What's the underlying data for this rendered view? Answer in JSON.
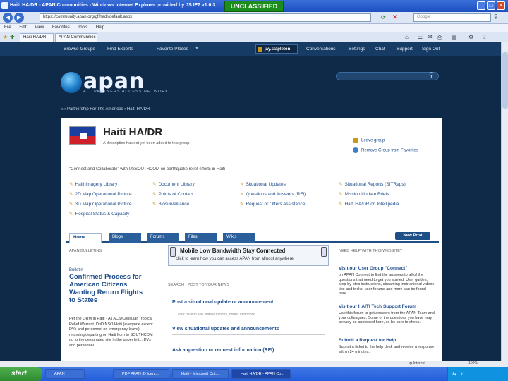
{
  "window": {
    "title": "Haiti HA/DR - APAN Communities - Windows Internet Explorer provided by JS IF7 v1.0.3",
    "classification": "UNCLASSIFIED"
  },
  "browser": {
    "address": "https://community.apan.org/gf/hadr/default.aspx",
    "search_placeholder": "Google",
    "menu": [
      "File",
      "Edit",
      "View",
      "Favorites",
      "Tools",
      "Help"
    ],
    "tabs": [
      "Haiti HA/DR",
      "APAN Communities"
    ]
  },
  "site_nav": {
    "items": [
      "Browse Groups",
      "Find Experts",
      "Favorite Places"
    ],
    "user": "jay.stapleton",
    "right_items": [
      "Conversations",
      "Settings",
      "Chat",
      "Support",
      "Sign Out"
    ]
  },
  "logo": {
    "name": "apan",
    "tagline": "ALL PARTNERS ACCESS NETWORK"
  },
  "breadcrumb": [
    "Partnership For The Americas",
    "Haiti HA/DR"
  ],
  "group": {
    "title": "Haiti HA/DR",
    "description": "A description has not yet been added to this group.",
    "actions": [
      "Leave group",
      "Remove Group from Favorites"
    ],
    "slogan": "\"Connect and Collaborate\" with USSOUTHCOM on earthquake relief efforts in Haiti"
  },
  "quick_links": [
    "Haiti Imagery Library",
    "2D Map Operational Picture",
    "3D Map Operational Picture",
    "Hospital Status & Capacity",
    "Document Library",
    "Points of Contact",
    "Biosurveillance",
    "Situational Updates",
    "Questions and Answers (RFI)",
    "Request or Offers Assistance",
    "Situational Reports (SITReps)",
    "Mission Update Briefs",
    "Haiti HA/DR on Intellipedia"
  ],
  "content_tabs": [
    "Home",
    "Blogs",
    "Forums",
    "Files",
    "Wikis"
  ],
  "new_post": "New Post",
  "bulletins": {
    "heading": "APAN BULLETINS",
    "category": "Bulletin",
    "title": "Confirmed Process for American Citizens Wanting Return Flights to States",
    "body": "Per the ORM in Haiti - All ACS/Consular Tropical Relief Warrant, DoD NSO Haiti (everyone except DVs and personnel on emergency leave) returning/departing on Haiti from to SOUTHCOM go to the designated site in the upper left... DVs and personnel..."
  },
  "mobile_banner": {
    "title": "Mobile  Low Bandwidth  Stay Connected",
    "subtitle": "click to learn how you can access APAN from almost anywhere"
  },
  "middle": {
    "heading": "SEARCH · POST TO YOUR NEWS",
    "links": [
      "Post a situational update or announcement",
      "View situational updates and announcements",
      "Ask a question or request information (RFI)"
    ],
    "meta": "click here to see status updates, notes, and more"
  },
  "right": {
    "heading": "NEED HELP WITH THIS WEBSITE?",
    "items": [
      {
        "title": "Visit our User Group \"Connect\"",
        "text": "on APAN Connect to find the answers to all of the questions that need to get you started. User guides, step-by-step instructions, streaming instructional videos tips and tricks, user forums and more can be found here."
      },
      {
        "title": "Visit our HAITI Tech Support Forum",
        "text": "Use this forum to get answers from the APAN Team and your colleagues. Some of the questions you have may already be answered here, so be sure to check."
      },
      {
        "title": "Submit a Request for Help",
        "text": "Submit a ticket to the help desk and receive a response within 24 minutes."
      }
    ]
  },
  "taskbar": {
    "start": "start",
    "tasks": [
      "APAN",
      "PDF APAN ID Ident...",
      "Haiti - Microsoft Out...",
      "Haiti HA/DR - APAN Co..."
    ],
    "status": "Internet",
    "zoom": "100%"
  },
  "colors": {
    "page_bg": "#0f2a49",
    "nav_bg": "#163c65",
    "link": "#1f4e8c",
    "classification_bg": "#1b8d1b"
  }
}
